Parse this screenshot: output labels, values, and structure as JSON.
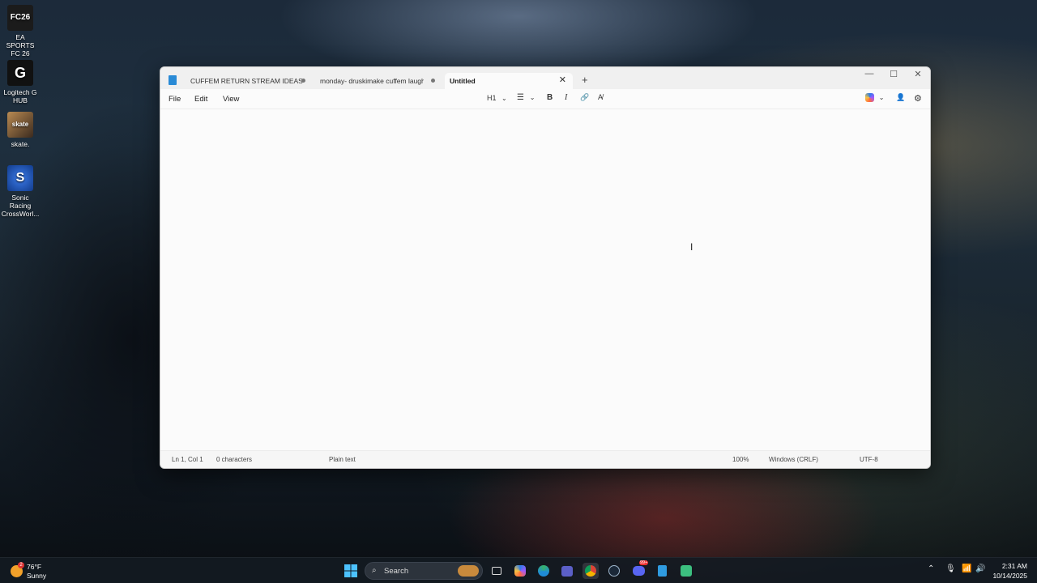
{
  "desktop": {
    "icons": [
      {
        "label": "EA SPORTS FC 26",
        "badge": "FC26",
        "color": "#1b1b1b"
      },
      {
        "label": "Logitech G HUB",
        "badge": "G",
        "color": "#111111"
      },
      {
        "label": "skate.",
        "badge": "skate",
        "color": "#7a5a3a"
      },
      {
        "label": "Sonic Racing CrossWorl...",
        "badge": "S",
        "color": "#1f5fd0"
      }
    ]
  },
  "window": {
    "tabs": [
      {
        "label": "CUFFEM RETURN STREAM IDEAS",
        "modified": true
      },
      {
        "label": "monday- druskimake cuffem laugh (",
        "modified": true
      },
      {
        "label": "Untitled",
        "active": true
      }
    ],
    "new_tab": "+",
    "controls": {
      "minimize": "—",
      "maximize": "☐",
      "close": "✕"
    },
    "menu": [
      "File",
      "Edit",
      "View"
    ],
    "toolbar": {
      "heading": "H1",
      "heading_chevron": "⌄",
      "list": "☰",
      "list_chevron": "⌄",
      "bold": "B",
      "italic": "I",
      "link": "🔗",
      "clear_format": "A̸",
      "copilot_chevron": "⌄",
      "account": "👤",
      "settings": "⚙"
    },
    "status": {
      "position": "Ln 1, Col 1",
      "characters": "0 characters",
      "format": "Plain text",
      "zoom": "100%",
      "line_endings": "Windows (CRLF)",
      "encoding": "UTF-8"
    }
  },
  "taskbar": {
    "weather": {
      "badge": "2",
      "temp": "76°F",
      "condition": "Sunny"
    },
    "search_placeholder": "Search",
    "apps": [
      "start",
      "search",
      "task-view",
      "copilot",
      "edge",
      "teams",
      "chrome",
      "steam",
      "discord",
      "notepad",
      "xbox"
    ],
    "discord_badge": "99+",
    "clock": {
      "time": "2:31 AM",
      "date": "10/14/2025"
    }
  }
}
